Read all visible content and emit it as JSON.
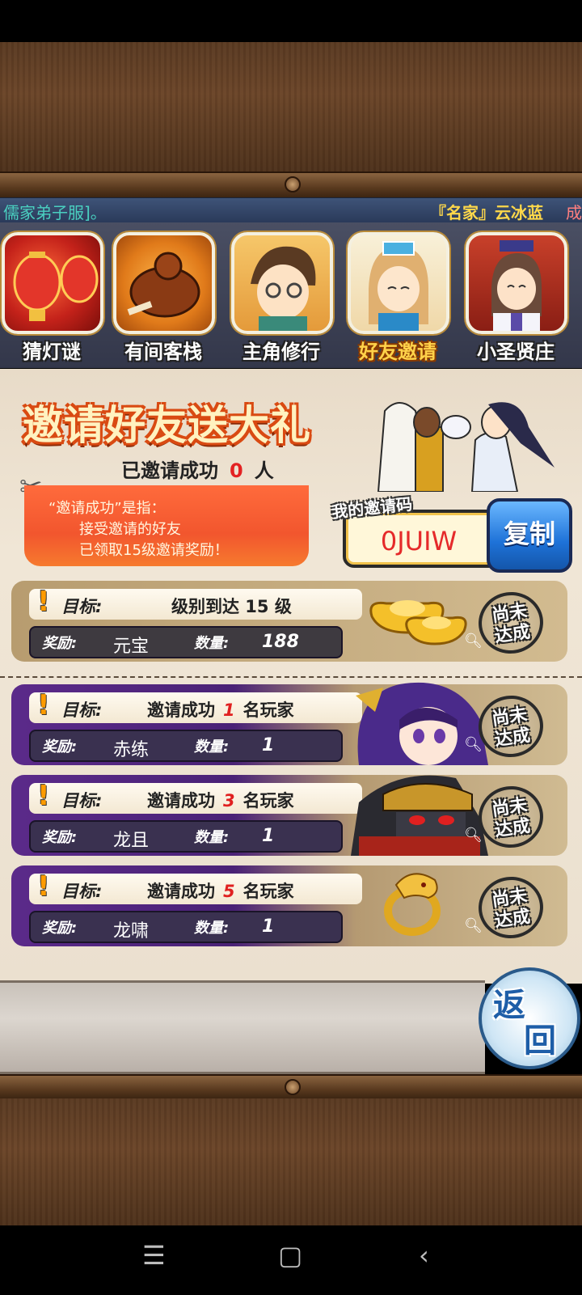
{
  "ticker": {
    "left_text": "儒家弟子服]。",
    "right_text": "『名家』云冰蓝",
    "right_tail": "成"
  },
  "tabs": [
    {
      "label": "猜灯谜",
      "icon": "lantern-icon",
      "active": false
    },
    {
      "label": "有间客栈",
      "icon": "roast-chicken-icon",
      "active": false
    },
    {
      "label": "主角修行",
      "icon": "hero-avatar-icon",
      "active": false
    },
    {
      "label": "好友邀请",
      "icon": "girl-avatar-icon",
      "active": true
    },
    {
      "label": "小圣贤庄",
      "icon": "scholar-avatar-icon",
      "active": false
    }
  ],
  "invite": {
    "title": "邀请好友送大礼",
    "success_prefix": "已邀请成功",
    "success_count": "0",
    "success_unit": "人",
    "note_line1": "“邀请成功”是指：",
    "note_line2": "接受邀请的好友",
    "note_line3": "已领取15级邀请奖励！",
    "code_label": "我的邀请码",
    "code_value": "0JUIW",
    "copy_label": "复制"
  },
  "tasks": [
    {
      "goal_label": "目标:",
      "goal_text": "级别到达 15 级",
      "reward_label": "奖励:",
      "reward_name": "元宝",
      "qty_label": "数量:",
      "qty_value": "188",
      "status": "尚未\n达成",
      "item_icon": "gold-ingot-icon"
    },
    {
      "goal_label": "目标:",
      "goal_prefix": "邀请成功",
      "goal_num": "1",
      "goal_suffix": "名玩家",
      "reward_label": "奖励:",
      "reward_name": "赤练",
      "qty_label": "数量:",
      "qty_value": "1",
      "status": "尚未\n达成",
      "item_icon": "chilian-portrait-icon"
    },
    {
      "goal_label": "目标:",
      "goal_prefix": "邀请成功",
      "goal_num": "3",
      "goal_suffix": "名玩家",
      "reward_label": "奖励:",
      "reward_name": "龙且",
      "qty_label": "数量:",
      "qty_value": "1",
      "status": "尚未\n达成",
      "item_icon": "longju-portrait-icon"
    },
    {
      "goal_label": "目标:",
      "goal_prefix": "邀请成功",
      "goal_num": "5",
      "goal_suffix": "名玩家",
      "reward_label": "奖励:",
      "reward_name": "龙啸",
      "qty_label": "数量:",
      "qty_value": "1",
      "status": "尚未\n达成",
      "item_icon": "dragon-ring-icon"
    }
  ],
  "return_button": {
    "char1": "返",
    "char2": "回"
  },
  "colors": {
    "accent_red": "#e32222",
    "tab_active": "#ffd24a",
    "copy_blue": "#1e72d8",
    "note_orange": "#f2562e"
  }
}
